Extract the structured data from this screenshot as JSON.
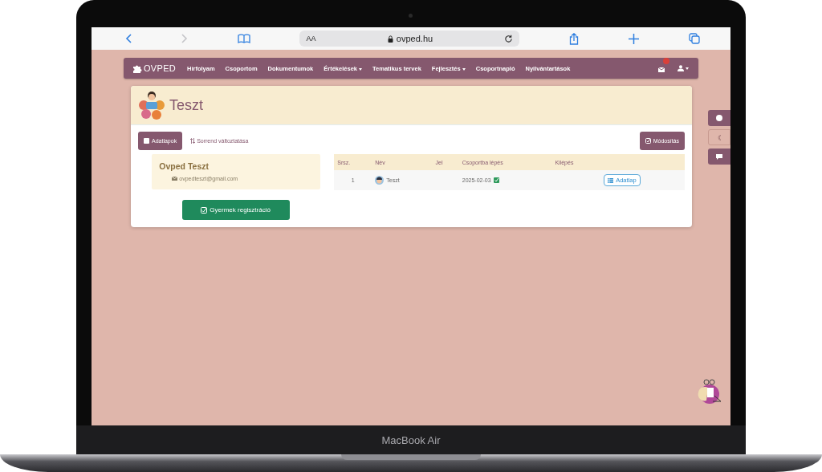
{
  "device": {
    "label": "MacBook Air"
  },
  "browser": {
    "text_size": "AA",
    "url": "ovped.hu"
  },
  "navbar": {
    "brand": "OVPED",
    "items": [
      {
        "label": "Hírfolyam",
        "dropdown": false
      },
      {
        "label": "Csoportom",
        "dropdown": false
      },
      {
        "label": "Dokumentumok",
        "dropdown": false
      },
      {
        "label": "Értékelések",
        "dropdown": true
      },
      {
        "label": "Tematikus tervek",
        "dropdown": false
      },
      {
        "label": "Fejlesztés",
        "dropdown": true
      },
      {
        "label": "Csoportnapló",
        "dropdown": false
      },
      {
        "label": "Nyilvántartások",
        "dropdown": false
      }
    ],
    "notification": true
  },
  "page": {
    "title": "Teszt"
  },
  "toolbar": {
    "datasheets_button": "Adatlapok",
    "reorder_link": "Sorrend változtatása",
    "edit_button": "Módosítás"
  },
  "teacher": {
    "name": "Ovped Teszt",
    "email": "ovpedteszt@gmail.com"
  },
  "register_button": "Gyermek regisztráció",
  "table": {
    "columns": [
      "Srsz.",
      "Név",
      "Jel",
      "Csoportba lépés",
      "Kilépés"
    ],
    "rows": [
      {
        "number": "1",
        "name": "Teszt",
        "sign": "",
        "joined": "2025-02-03",
        "left": "",
        "action": "Adatlap"
      }
    ]
  }
}
